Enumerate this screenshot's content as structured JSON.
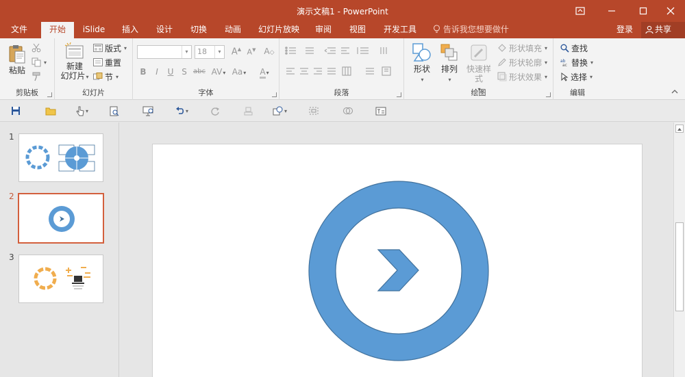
{
  "window": {
    "title": "演示文稿1 - PowerPoint"
  },
  "tabs": [
    {
      "label": "文件"
    },
    {
      "label": "开始"
    },
    {
      "label": "iSlide"
    },
    {
      "label": "插入"
    },
    {
      "label": "设计"
    },
    {
      "label": "切换"
    },
    {
      "label": "动画"
    },
    {
      "label": "幻灯片放映"
    },
    {
      "label": "审阅"
    },
    {
      "label": "视图"
    },
    {
      "label": "开发工具"
    }
  ],
  "active_tab": "开始",
  "tell_me": "告诉我您想要做什么...",
  "account": {
    "login": "登录",
    "share": "共享"
  },
  "ribbon": {
    "clipboard": {
      "label": "剪贴板",
      "paste": "粘贴"
    },
    "slides": {
      "label": "幻灯片",
      "new_slide_1": "新建",
      "new_slide_2": "幻灯片",
      "layout": "版式",
      "reset": "重置",
      "section": "节"
    },
    "font": {
      "label": "字体",
      "font_size": "18",
      "bold": "B",
      "italic": "I",
      "underline": "U",
      "shadow": "S",
      "strike": "abc",
      "spacing": "AV",
      "case": "Aa",
      "grow": "A",
      "shrink": "A",
      "clear": "A",
      "color": "A"
    },
    "paragraph": {
      "label": "段落"
    },
    "drawing": {
      "label": "绘图",
      "shapes": "形状",
      "arrange": "排列",
      "quick_styles": "快速样式",
      "shape_fill": "形状填充",
      "shape_outline": "形状轮廓",
      "shape_effects": "形状效果"
    },
    "editing": {
      "label": "编辑",
      "find": "查找",
      "replace": "替换",
      "select": "选择"
    }
  },
  "slides_panel": {
    "slides": [
      {
        "number": "1"
      },
      {
        "number": "2"
      },
      {
        "number": "3"
      }
    ],
    "active_number": "2"
  },
  "colors": {
    "accent": "#b7472a",
    "ring": "#5b9bd5",
    "ring_stroke": "#41719c",
    "thumb_orange": "#f0ad4e"
  }
}
